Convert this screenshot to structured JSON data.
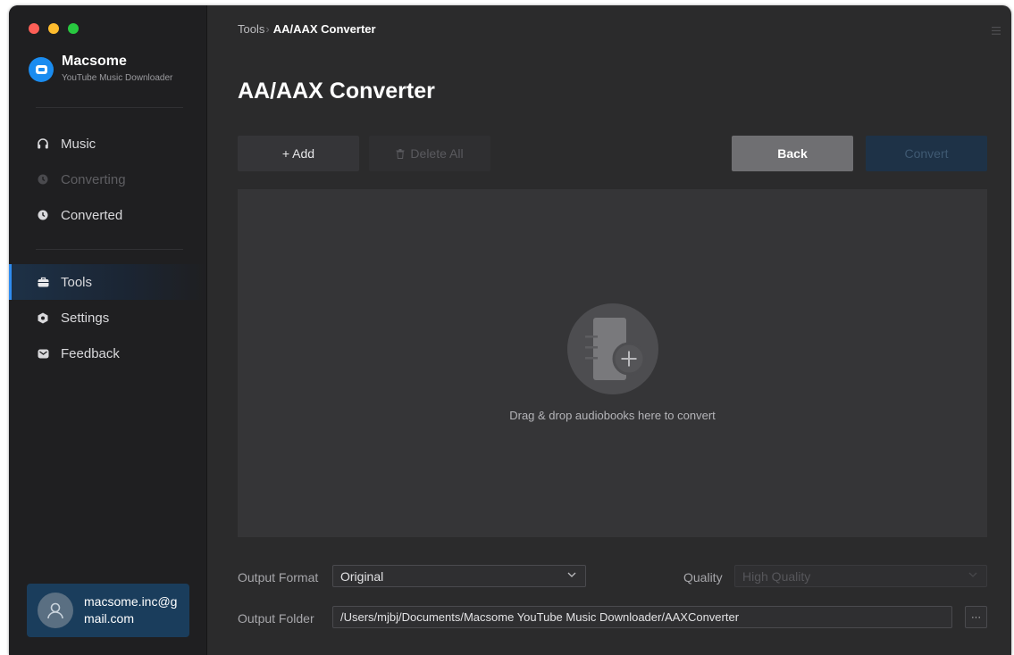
{
  "app": {
    "name": "Macsome",
    "subtitle": "YouTube Music Downloader"
  },
  "sidebar": {
    "items": [
      {
        "label": "Music",
        "icon": "headphones-icon",
        "state": "normal"
      },
      {
        "label": "Converting",
        "icon": "clock-icon",
        "state": "disabled"
      },
      {
        "label": "Converted",
        "icon": "clock-icon",
        "state": "normal"
      },
      {
        "label": "Tools",
        "icon": "toolbox-icon",
        "state": "active"
      },
      {
        "label": "Settings",
        "icon": "gear-icon",
        "state": "normal"
      },
      {
        "label": "Feedback",
        "icon": "mail-icon",
        "state": "normal"
      }
    ],
    "account": {
      "email": "macsome.inc@gmail.com"
    }
  },
  "breadcrumb": {
    "root": "Tools",
    "separator": "›",
    "current": "AA/AAX Converter"
  },
  "page": {
    "title": "AA/AAX Converter"
  },
  "toolbar": {
    "add_label": "+ Add",
    "delete_all_label": "Delete All",
    "back_label": "Back",
    "convert_label": "Convert"
  },
  "dropzone": {
    "hint": "Drag & drop audiobooks here to convert"
  },
  "settings": {
    "output_format_label": "Output Format",
    "output_format_value": "Original",
    "quality_label": "Quality",
    "quality_value": "High Quality",
    "output_folder_label": "Output Folder",
    "output_folder_value": "/Users/mjbj/Documents/Macsome YouTube Music Downloader/AAXConverter",
    "browse_label": "···"
  },
  "colors": {
    "accent": "#2f8cf0",
    "background": "#2b2b2c",
    "sidebar": "#1f1f21",
    "account_card": "#1a3d5c"
  }
}
